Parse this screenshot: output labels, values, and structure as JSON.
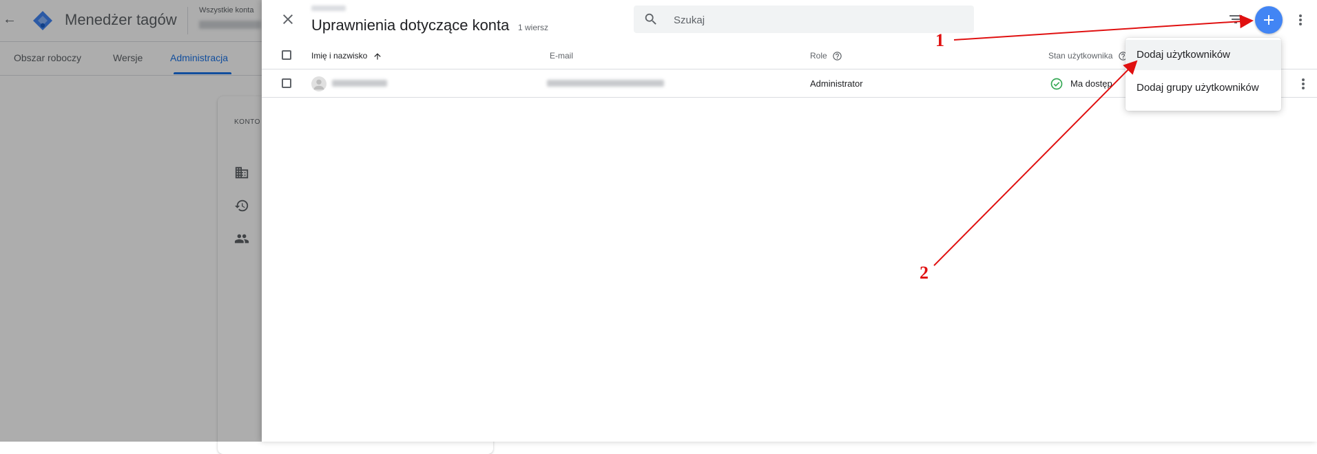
{
  "background": {
    "app_title": "Menedżer tagów",
    "accounts_label": "Wszystkie konta",
    "tabs": [
      {
        "label": "Obszar roboczy"
      },
      {
        "label": "Wersje"
      },
      {
        "label": "Administracja"
      }
    ],
    "card_label": "KONTO"
  },
  "panel": {
    "title": "Uprawnienia dotyczące konta",
    "row_count": "1 wiersz",
    "search_placeholder": "Szukaj"
  },
  "table": {
    "columns": [
      {
        "label": "Imię i nazwisko"
      },
      {
        "label": "E-mail"
      },
      {
        "label": "Role"
      },
      {
        "label": "Stan użytkownika"
      }
    ],
    "rows": [
      {
        "role": "Administrator",
        "status": "Ma dostęp"
      }
    ]
  },
  "menu": {
    "items": [
      {
        "label": "Dodaj użytkowników"
      },
      {
        "label": "Dodaj grupy użytkowników"
      }
    ]
  },
  "annotations": {
    "labels": [
      "1",
      "2"
    ],
    "color": "#e01010"
  },
  "colors": {
    "accent": "#4285f4",
    "active_tab": "#1a73e8",
    "status_ok": "#34a853"
  }
}
